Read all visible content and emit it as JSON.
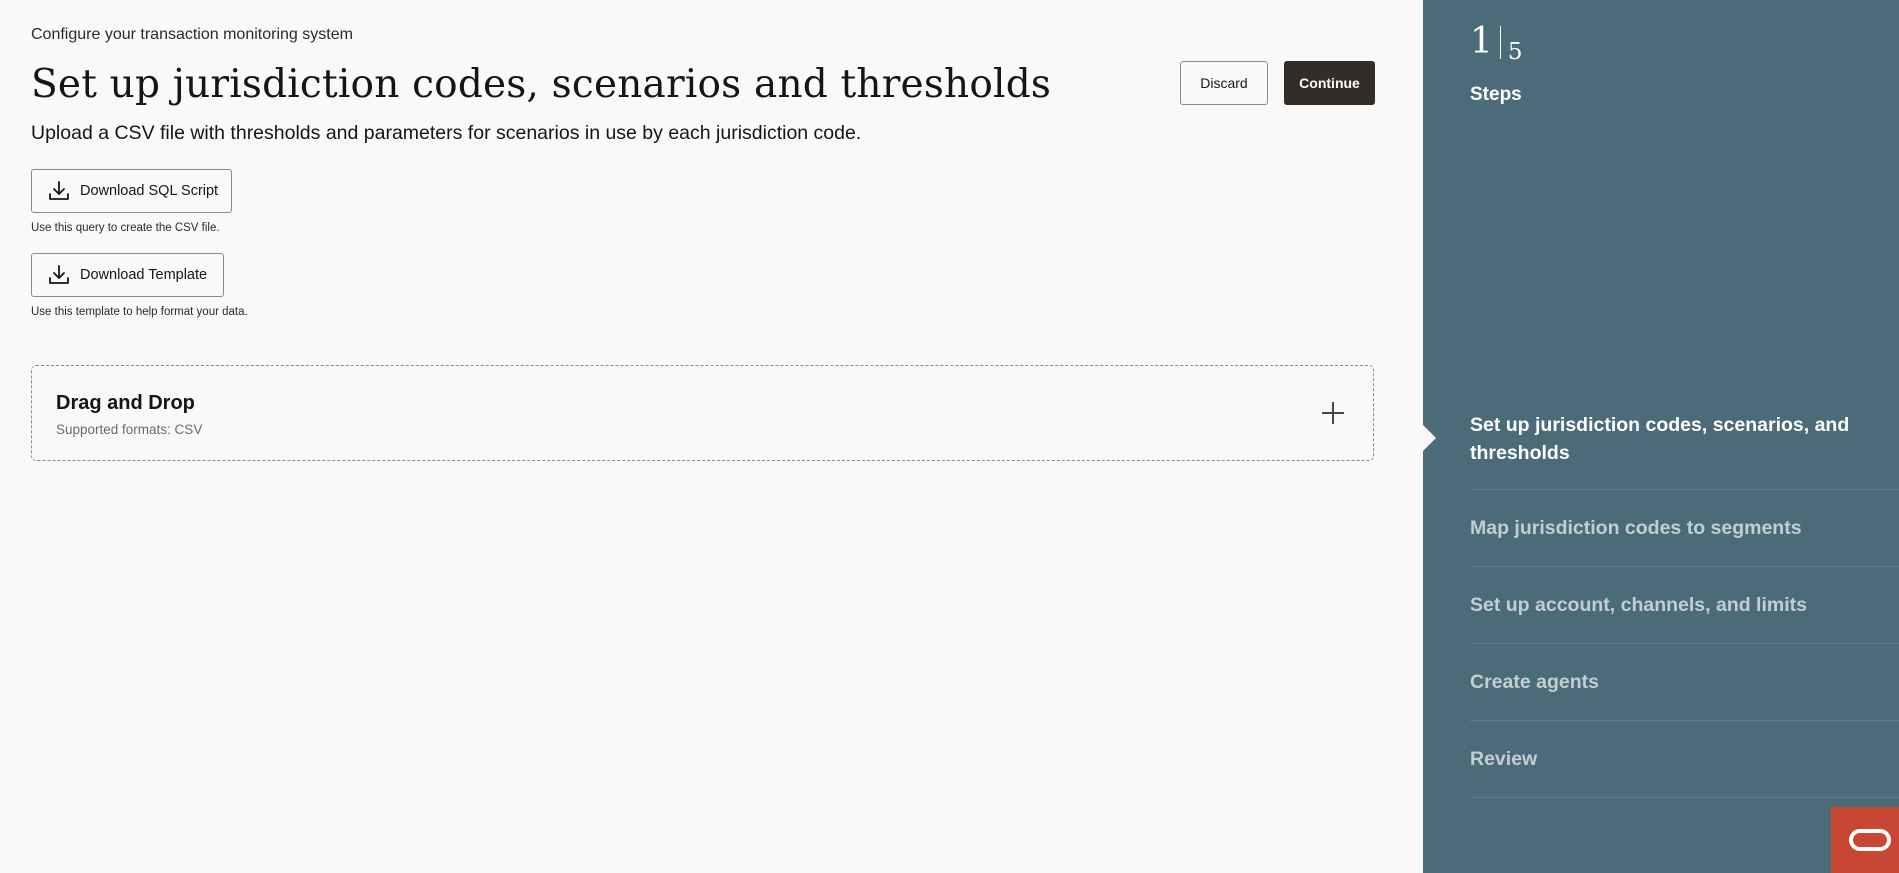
{
  "header": {
    "kicker": "Configure your transaction monitoring system",
    "title": "Set up jurisdiction codes, scenarios and thresholds",
    "subtitle": "Upload a CSV file with thresholds and parameters for scenarios in use by each jurisdiction code."
  },
  "actions": {
    "discard_label": "Discard",
    "continue_label": "Continue"
  },
  "downloads": [
    {
      "label": "Download SQL Script",
      "helper": "Use this query to create the CSV file.",
      "icon": "download-icon"
    },
    {
      "label": "Download Template",
      "helper": "Use this template to help format your data.",
      "icon": "download-icon"
    }
  ],
  "dropzone": {
    "title": "Drag and Drop",
    "subtitle": "Supported formats: CSV",
    "icon": "plus-icon"
  },
  "sidebar": {
    "current_step": "1",
    "total_steps": "5",
    "steps_label": "Steps",
    "steps": [
      {
        "label": "Set up jurisdiction codes, scenarios, and thresholds",
        "active": true
      },
      {
        "label": "Map jurisdiction codes to segments",
        "active": false
      },
      {
        "label": "Set up account, channels, and limits",
        "active": false
      },
      {
        "label": "Create agents",
        "active": false
      },
      {
        "label": "Review",
        "active": false
      }
    ]
  },
  "colors": {
    "background": "#faf9f7",
    "sidebar": "#4a6b77",
    "primary_button": "#312d2a",
    "brand": "#c74634"
  }
}
